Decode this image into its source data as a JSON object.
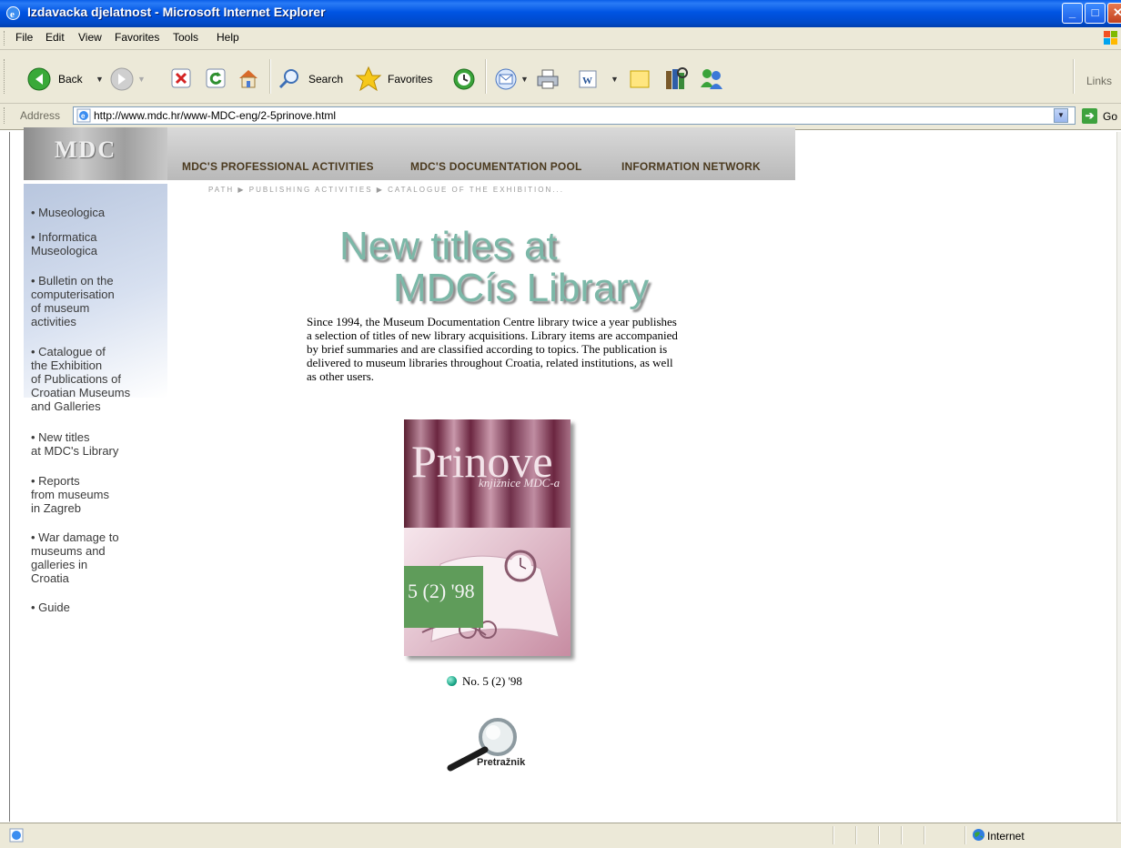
{
  "window": {
    "title": "Izdavacka djelatnost - Microsoft Internet Explorer",
    "minimize": "_",
    "maximize": "□",
    "close": "✕"
  },
  "menu": {
    "items": [
      "File",
      "Edit",
      "View",
      "Favorites",
      "Tools",
      "Help"
    ]
  },
  "toolbar": {
    "back_label": "Back",
    "search_label": "Search",
    "favorites_label": "Favorites",
    "links_label": "Links"
  },
  "address": {
    "label": "Address",
    "url": "http://www.mdc.hr/www-MDC-eng/2-5prinove.html",
    "go_label": "Go"
  },
  "banner": {
    "logo": "MDC",
    "nav": [
      "MDC'S PROFESSIONAL ACTIVITIES",
      "MDC'S DOCUMENTATION POOL",
      "INFORMATION NETWORK"
    ]
  },
  "path": "PATH  ▶ PUBLISHING ACTIVITIES  ▶ CATALOGUE OF THE EXHIBITION...",
  "sidebar": {
    "items": [
      "• Museologica",
      "• Informatica\nMuseologica",
      "• Bulletin on the\ncomputerisation\nof museum\nactivities",
      "• Catalogue of\nthe Exhibition\nof Publications of\nCroatian Museums\nand Galleries",
      "• New titles\nat MDC's Library",
      "• Reports\nfrom museums\nin Zagreb",
      "• War damage to\nmuseums and\ngalleries in\nCroatia",
      "• Guide"
    ]
  },
  "main": {
    "headline_line1": "New titles at",
    "headline_line2": "MDCís Library",
    "intro": "Since 1994, the Museum Documentation Centre library twice a year publishes a selection of titles of new library acquisitions. Library items are accompanied by brief summaries and are classified according to topics. The publication is delivered to museum libraries throughout Croatia, related institutions, as well as other users.",
    "cover": {
      "title": "Prinove",
      "subtitle": "knjižnice MDC-a",
      "issue": "5 (2) '98"
    },
    "issue_link": "No. 5 (2) '98",
    "search_label": "Pretražnik"
  },
  "status": {
    "zone": "Internet"
  },
  "colors": {
    "titlebar": "#0054e3",
    "chrome": "#ece9d8",
    "headline": "#7cb8a8",
    "cover_accent": "#5f9c5a"
  }
}
